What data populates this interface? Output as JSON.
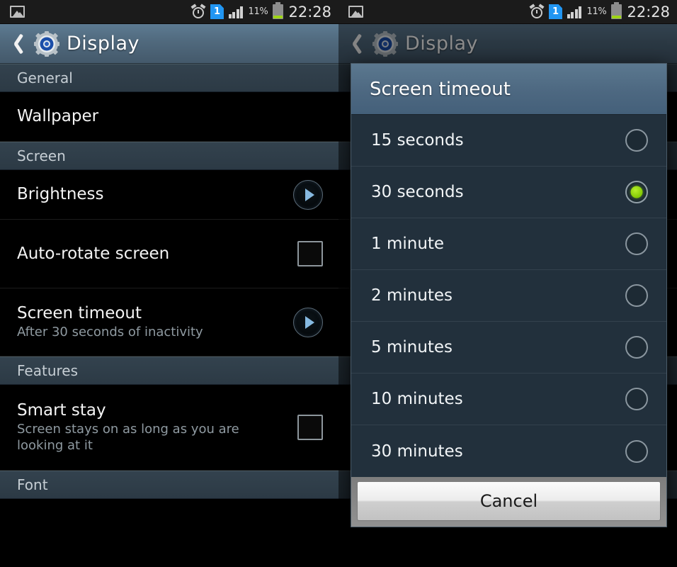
{
  "status_bar": {
    "gallery_icon": "gallery-icon",
    "alarm_icon": "alarm-icon",
    "sim_icon_label": "1",
    "signal_icon": "signal-bars-icon",
    "battery_percent": "11%",
    "battery_icon": "battery-icon",
    "clock": "22:28"
  },
  "app": {
    "back_icon": "back-chevron-icon",
    "gear_icon": "settings-gear-icon",
    "title": "Display"
  },
  "settings_list": {
    "sections": [
      {
        "header": "General",
        "rows": [
          {
            "title": "Wallpaper",
            "subtitle": "",
            "control": "none"
          }
        ]
      },
      {
        "header": "Screen",
        "rows": [
          {
            "title": "Brightness",
            "subtitle": "",
            "control": "arrow"
          },
          {
            "title": "Auto-rotate screen",
            "subtitle": "",
            "control": "checkbox",
            "checked": false
          },
          {
            "title": "Screen timeout",
            "subtitle": "After 30 seconds of inactivity",
            "control": "arrow"
          }
        ]
      },
      {
        "header": "Features",
        "rows": [
          {
            "title": "Smart stay",
            "subtitle": "Screen stays on as long as you are looking at it",
            "control": "checkbox",
            "checked": false
          }
        ]
      },
      {
        "header": "Font",
        "rows": []
      }
    ]
  },
  "dialog": {
    "title": "Screen timeout",
    "options": [
      {
        "label": "15 seconds",
        "selected": false
      },
      {
        "label": "30 seconds",
        "selected": true
      },
      {
        "label": "1 minute",
        "selected": false
      },
      {
        "label": "2 minutes",
        "selected": false
      },
      {
        "label": "5 minutes",
        "selected": false
      },
      {
        "label": "10 minutes",
        "selected": false
      },
      {
        "label": "30 minutes",
        "selected": false
      }
    ],
    "cancel_label": "Cancel",
    "behind_section_label": "Font"
  },
  "colors": {
    "title_bar": "#50697d",
    "section_header": "#2f3d49",
    "dialog_body": "#22303c",
    "dialog_header": "#4d6881",
    "selected_radio": "#8ccd0f",
    "accent_arrow": "#86b9e0",
    "sim_badge": "#2196f3",
    "battery_fill": "#9fd614"
  }
}
